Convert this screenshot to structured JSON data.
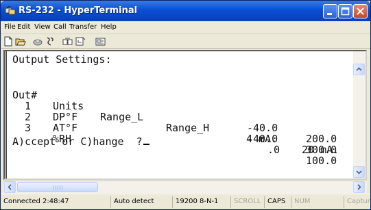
{
  "window": {
    "title": "RS-232 - HyperTerminal",
    "colors": {
      "titlebar": "#0a4fd6",
      "close_button": "#c8472a",
      "background": "#ece9d8"
    }
  },
  "menu": {
    "items": [
      "File",
      "Edit",
      "View",
      "Call",
      "Transfer",
      "Help"
    ]
  },
  "toolbar": {
    "icons": [
      "new-icon",
      "open-icon",
      "connect-icon",
      "disconnect-icon",
      "send-icon",
      "receive-icon",
      "properties-icon"
    ]
  },
  "terminal": {
    "heading": "Output Settings:",
    "header": {
      "out": "Out#",
      "units": "Units",
      "range_l": "Range_L",
      "range_h": "Range_H",
      "ma4": "4 mA.",
      "ma20": "20 mA."
    },
    "rows": [
      {
        "out": "1",
        "units": "DP°F",
        "ma4": "-40.0",
        "ma20": "200.0"
      },
      {
        "out": "2",
        "units": "AT°F",
        "ma4": "-40.0",
        "ma20": "300.0"
      },
      {
        "out": "3",
        "units": "%RH",
        "ma4": ".0",
        "ma20": "100.0"
      }
    ],
    "prompt": "A)ccept or C)hange  ?"
  },
  "status": {
    "connected": "Connected 2:48:47",
    "detect": "Auto detect",
    "settings": "19200 8-N-1",
    "scroll": "SCROLL",
    "caps": "CAPS",
    "num": "NUM",
    "capture": "Capture"
  }
}
